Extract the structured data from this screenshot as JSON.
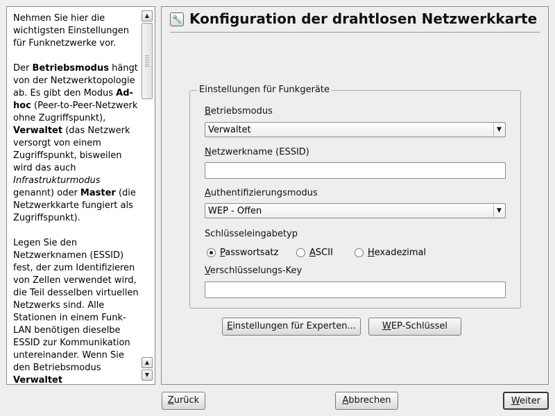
{
  "help": {
    "p1": "Nehmen Sie hier die wichtigsten Einstellungen für Funknetzwerke vor.",
    "p2_a": "Der ",
    "p2_b": "Betriebsmodus",
    "p2_c": " hängt von der Netzwerktopologie ab. Es gibt den Modus ",
    "p2_d": "Ad-hoc",
    "p2_e": " (Peer-to-Peer-Netzwerk ohne Zugriffspunkt), ",
    "p2_f": "Verwaltet",
    "p2_g": " (das Netzwerk versorgt von einem Zugriffspunkt, bisweilen wird das auch ",
    "p2_h": "Infrastrukturmodus",
    "p2_i": " genannt) oder ",
    "p2_j": "Master",
    "p2_k": " (die Netzwerkkarte fungiert als Zugriffspunkt).",
    "p3_a": "Legen Sie den Netzwerknamen (ESSID) fest, der zum Identifizieren von Zellen verwendet wird, die Teil desselben virtuellen Netzwerks sind. Alle Stationen in einem Funk-LAN benötigen dieselbe ESSID zur Kommunikation untereinander. Wenn Sie den Betriebsmodus ",
    "p3_b": "Verwaltet"
  },
  "header": {
    "title": "Konfiguration der drahtlosen Netzwerkkarte"
  },
  "group": {
    "title": "Einstellungen für Funkgeräte",
    "mode_label_u": "B",
    "mode_label_rest": "etriebsmodus",
    "mode_value": "Verwaltet",
    "essid_label_u": "N",
    "essid_label_rest": "etzwerkname (ESSID)",
    "essid_value": "",
    "auth_label_u": "A",
    "auth_label_rest": "uthentifizierungsmodus",
    "auth_value": "WEP - Offen",
    "keytype_label": "Schlüsseleingabetyp",
    "radio_pass_u": "P",
    "radio_pass_rest": "asswortsatz",
    "radio_ascii_u": "A",
    "radio_ascii_rest": "SCII",
    "radio_hex_u": "H",
    "radio_hex_rest": "exadezimal",
    "selected_key_type": "Passwortsatz",
    "key_label_u": "V",
    "key_label_rest": "erschlüsselungs-Key",
    "key_value": ""
  },
  "buttons": {
    "expert_u": "E",
    "expert_rest": "instellungen für Experten...",
    "wep_u": "W",
    "wep_rest": "EP-Schlüssel",
    "back_u": "Z",
    "back_rest": "urück",
    "abort_u": "A",
    "abort_rest": "bbrechen",
    "next_u": "W",
    "next_rest": "eiter"
  }
}
